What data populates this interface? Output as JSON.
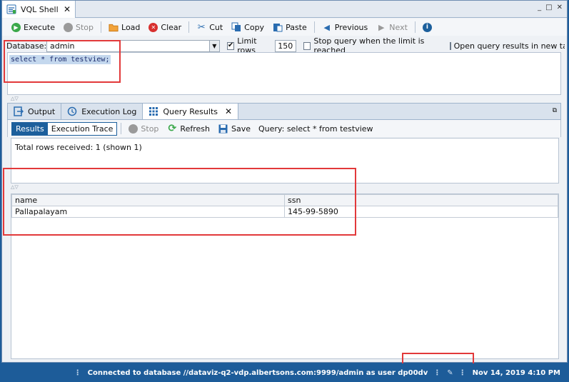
{
  "window": {
    "tab_title": "VQL Shell",
    "close_glyph": "✕",
    "controls": [
      "_",
      "□",
      "✕"
    ]
  },
  "toolbar": {
    "execute": "Execute",
    "stop": "Stop",
    "load": "Load",
    "clear": "Clear",
    "cut": "Cut",
    "copy": "Copy",
    "paste": "Paste",
    "previous": "Previous",
    "next": "Next"
  },
  "db": {
    "label": "Database:",
    "value": "admin",
    "limit_label": "Limit rows",
    "limit_value": "150",
    "limit_checked": "✔",
    "stop_query_label": "Stop query when the limit is reached",
    "open_new_tab_label": "Open query results in new tab"
  },
  "editor": {
    "query": "select * from testview;"
  },
  "lower_tabs": {
    "output": "Output",
    "execution_log": "Execution Log",
    "query_results": "Query Results"
  },
  "results_toolbar": {
    "results": "Results",
    "execution_trace": "Execution Trace",
    "stop": "Stop",
    "refresh": "Refresh",
    "save": "Save",
    "query_text": "Query: select * from testview"
  },
  "message": "Total rows received: 1 (shown 1)",
  "grid": {
    "columns": [
      "name",
      "ssn"
    ],
    "rows": [
      [
        "Pallapalayam",
        "145-99-5890"
      ]
    ]
  },
  "status": {
    "connection": "Connected to database //dataviz-q2-vdp.albertsons.com:9999/admin as user dp00dv",
    "datetime": "Nov 14, 2019 4:10 PM"
  },
  "colors": {
    "accent": "#1d5c99",
    "highlight": "#e2393a",
    "execute_green": "#3aa84a",
    "clear_red": "#d8302f"
  }
}
